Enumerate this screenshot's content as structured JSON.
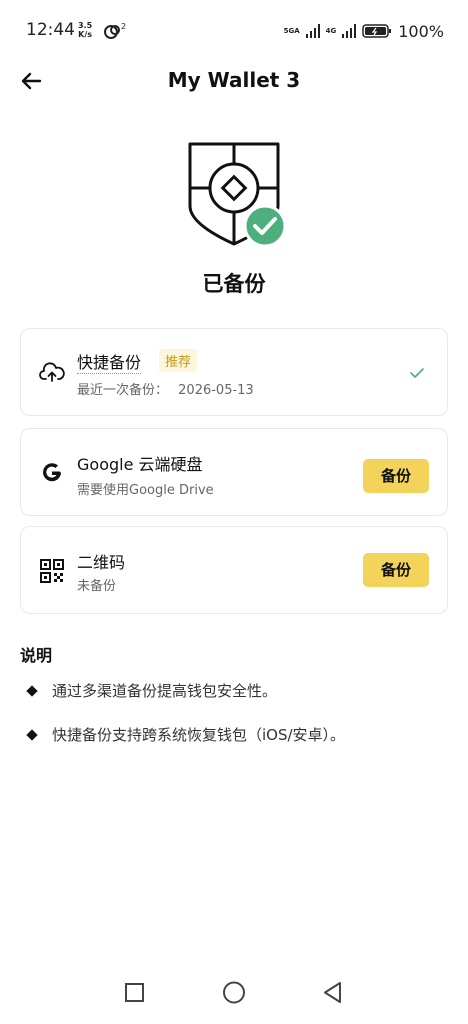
{
  "status_bar": {
    "time": "12:44",
    "speed_value": "3.5",
    "speed_unit": "K/s",
    "sync_count": "2",
    "net1": "5GA",
    "net2": "4G",
    "battery": "100%"
  },
  "header": {
    "title": "My Wallet 3"
  },
  "status": {
    "heading": "已备份",
    "accent_color": "#4caf7d"
  },
  "options": [
    {
      "title": "快捷备份",
      "tag": "推荐",
      "subtitle_prefix": "最近一次备份：",
      "date": "2026-05-13",
      "icon": "cloud-upload-icon"
    },
    {
      "title": "Google 云端硬盘",
      "subtitle": "需要使用Google Drive",
      "button": "备份",
      "icon": "google-icon"
    },
    {
      "title": "二维码",
      "subtitle": "未备份",
      "button": "备份",
      "icon": "qr-code-icon"
    }
  ],
  "notes": {
    "title": "说明",
    "items": [
      "通过多渠道备份提高钱包安全性。",
      "快捷备份支持跨系统恢复钱包（iOS/安卓）。"
    ]
  },
  "colors": {
    "button_yellow": "#f4d35b",
    "tag_text": "#c89a12"
  }
}
